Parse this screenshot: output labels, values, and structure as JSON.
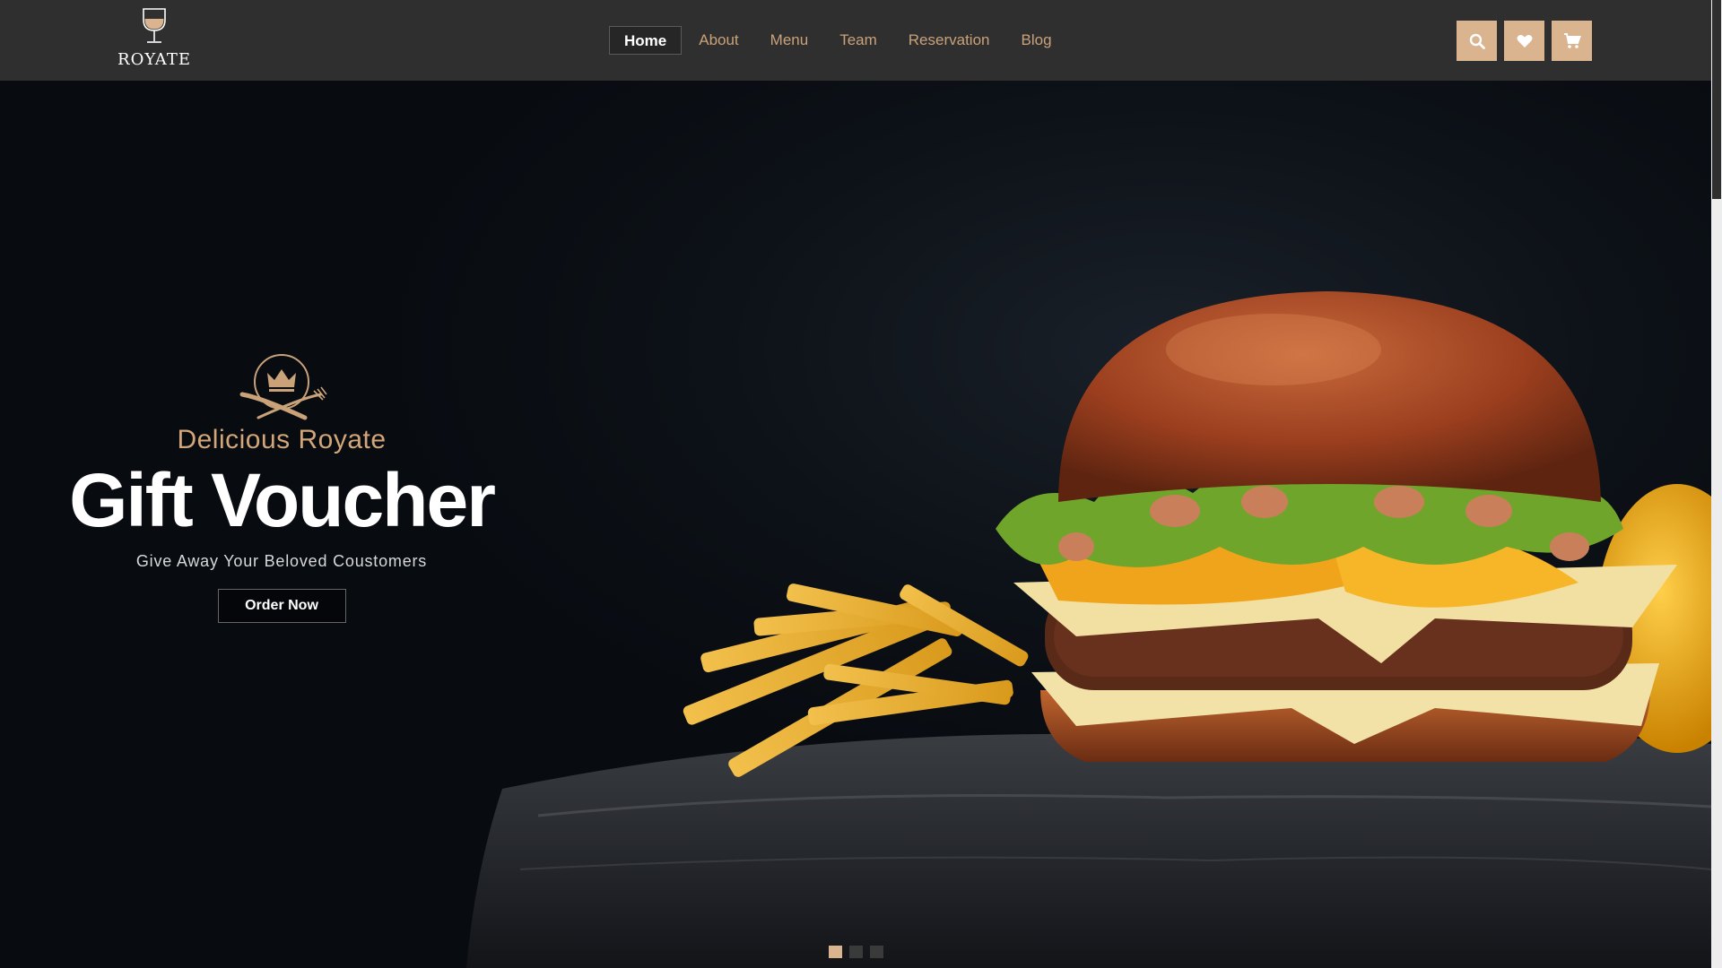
{
  "brand": {
    "name": "ROYATE",
    "logo_icon": "wine-glass-icon"
  },
  "nav": {
    "items": [
      {
        "label": "Home",
        "active": true
      },
      {
        "label": "About",
        "active": false
      },
      {
        "label": "Menu",
        "active": false
      },
      {
        "label": "Team",
        "active": false
      },
      {
        "label": "Reservation",
        "active": false
      },
      {
        "label": "Blog",
        "active": false
      }
    ]
  },
  "actions": {
    "icons": [
      "search-icon",
      "heart-icon",
      "cart-icon"
    ]
  },
  "hero": {
    "emblem_icon": "crown-cutlery-icon",
    "subtitle": "Delicious Royate",
    "title": "Gift Voucher",
    "description": "Give Away Your Beloved Coustomers",
    "button_label": "Order Now",
    "image": "burger-with-fries-photo"
  },
  "slider": {
    "total": 3,
    "active": 1
  },
  "colors": {
    "accent": "#d9b48e",
    "header_bg": "#2f2f2f",
    "hero_bg": "#0a0e13",
    "text_gold": "#c9a27a"
  }
}
